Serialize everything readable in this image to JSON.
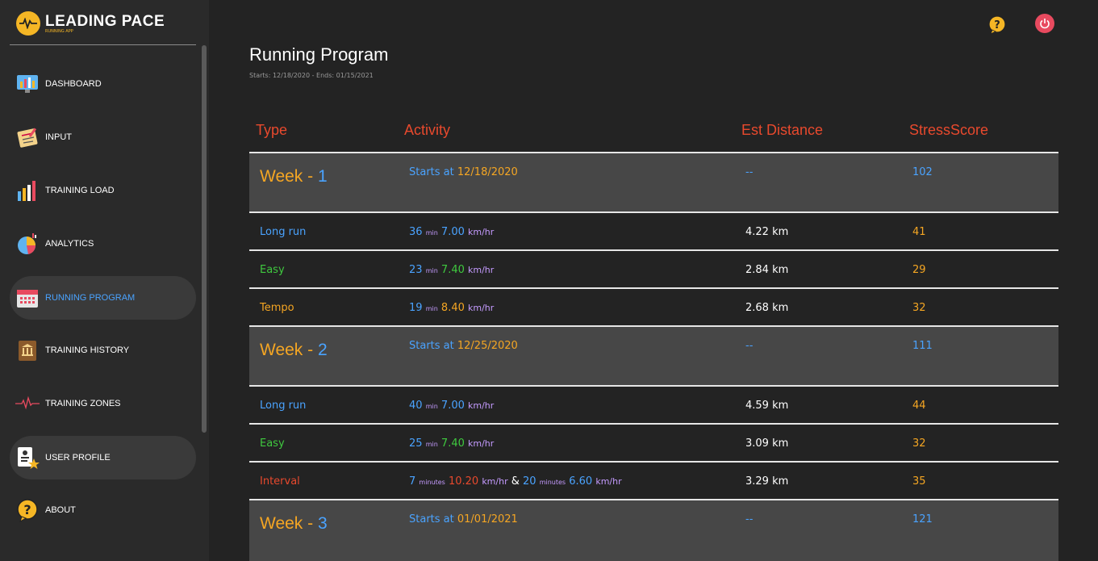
{
  "app": {
    "title": "LEADING PACE",
    "subtitle": "RUNNING APP"
  },
  "nav": [
    {
      "label": "DASHBOARD",
      "icon": "dashboard-icon"
    },
    {
      "label": "INPUT",
      "icon": "notepad-icon"
    },
    {
      "label": "TRAINING LOAD",
      "icon": "bar-chart-icon"
    },
    {
      "label": "ANALYTICS",
      "icon": "pie-chart-icon"
    },
    {
      "label": "RUNNING PROGRAM",
      "icon": "calendar-icon"
    },
    {
      "label": "TRAINING HISTORY",
      "icon": "history-book-icon"
    },
    {
      "label": "TRAINING ZONES",
      "icon": "heartbeat-icon"
    },
    {
      "label": "USER PROFILE",
      "icon": "user-profile-icon"
    },
    {
      "label": "ABOUT",
      "icon": "question-icon"
    }
  ],
  "page": {
    "title": "Running Program",
    "subtitle": "Starts: 12/18/2020 - Ends: 01/15/2021"
  },
  "table": {
    "headers": [
      "Type",
      "Activity",
      "Est Distance",
      "StressScore"
    ],
    "weeks": [
      {
        "label": "Week - ",
        "num": "1",
        "starts_label": "Starts at",
        "date": "12/18/2020",
        "distance": "--",
        "score": "102",
        "activities": [
          {
            "type": "Long run",
            "dur": "36",
            "dur_unit": "min",
            "speed": "7.00",
            "speed_unit": "km/hr",
            "distance": "4.22 km",
            "score": "41"
          },
          {
            "type": "Easy",
            "dur": "23",
            "dur_unit": "min",
            "speed": "7.40",
            "speed_unit": "km/hr",
            "distance": "2.84 km",
            "score": "29"
          },
          {
            "type": "Tempo",
            "dur": "19",
            "dur_unit": "min",
            "speed": "8.40",
            "speed_unit": "km/hr",
            "distance": "2.68 km",
            "score": "32"
          }
        ]
      },
      {
        "label": "Week - ",
        "num": "2",
        "starts_label": "Starts at",
        "date": "12/25/2020",
        "distance": "--",
        "score": "111",
        "activities": [
          {
            "type": "Long run",
            "dur": "40",
            "dur_unit": "min",
            "speed": "7.00",
            "speed_unit": "km/hr",
            "distance": "4.59 km",
            "score": "44"
          },
          {
            "type": "Easy",
            "dur": "25",
            "dur_unit": "min",
            "speed": "7.40",
            "speed_unit": "km/hr",
            "distance": "3.09 km",
            "score": "32"
          },
          {
            "type": "Interval",
            "dur": "7",
            "dur_unit": "minutes",
            "speed": "10.20",
            "speed_unit": "km/hr",
            "amp": "&",
            "dur2": "20",
            "dur2_unit": "minutes",
            "speed2": "6.60",
            "speed2_unit": "km/hr",
            "distance": "3.29 km",
            "score": "35"
          }
        ]
      },
      {
        "label": "Week - ",
        "num": "3",
        "starts_label": "Starts at",
        "date": "01/01/2021",
        "distance": "--",
        "score": "121"
      }
    ]
  },
  "colors": {
    "accent_blue": "#4aa3ff",
    "accent_orange": "#f5a623",
    "header_red": "#e8492d",
    "easy_green": "#3fc93f"
  }
}
